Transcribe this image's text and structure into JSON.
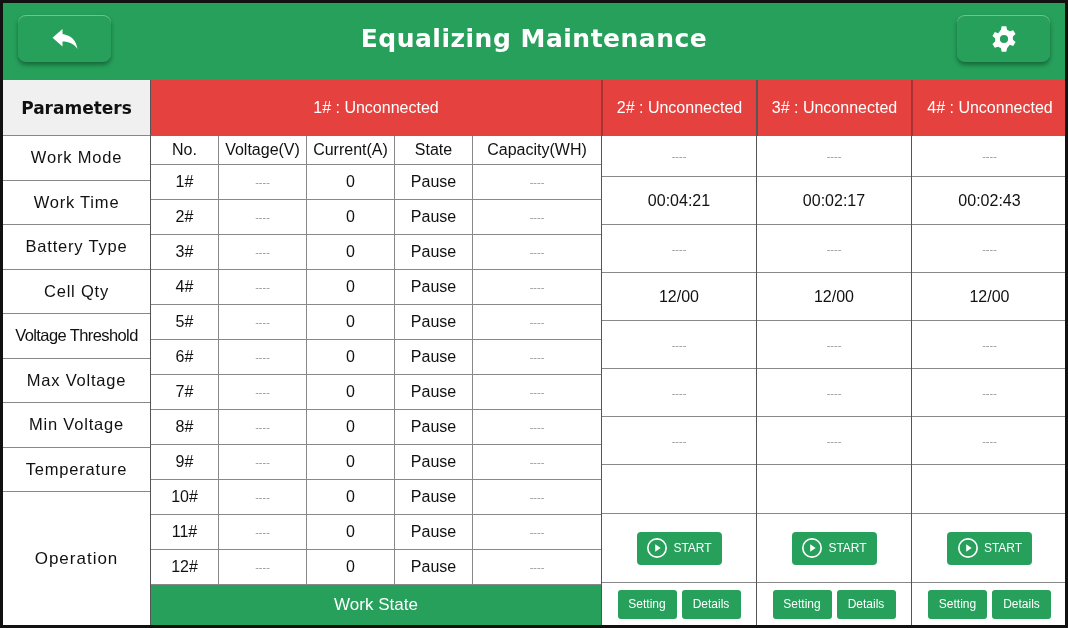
{
  "header": {
    "title": "Equalizing Maintenance"
  },
  "parameters": {
    "title": "Parameters",
    "items": [
      "Work Mode",
      "Work Time",
      "Battery Type",
      "Cell Qty",
      "Voltage Threshold",
      "Max Voltage",
      "Min Voltage",
      "Temperature"
    ],
    "operation": "Operation"
  },
  "device_1": {
    "status": "1# : Unconnected",
    "columns": [
      "No.",
      "Voltage(V)",
      "Current(A)",
      "State",
      "Capacity(WH)"
    ],
    "rows": [
      [
        "1#",
        "----",
        "0",
        "Pause",
        "----"
      ],
      [
        "2#",
        "----",
        "0",
        "Pause",
        "----"
      ],
      [
        "3#",
        "----",
        "0",
        "Pause",
        "----"
      ],
      [
        "4#",
        "----",
        "0",
        "Pause",
        "----"
      ],
      [
        "5#",
        "----",
        "0",
        "Pause",
        "----"
      ],
      [
        "6#",
        "----",
        "0",
        "Pause",
        "----"
      ],
      [
        "7#",
        "----",
        "0",
        "Pause",
        "----"
      ],
      [
        "8#",
        "----",
        "0",
        "Pause",
        "----"
      ],
      [
        "9#",
        "----",
        "0",
        "Pause",
        "----"
      ],
      [
        "10#",
        "----",
        "0",
        "Pause",
        "----"
      ],
      [
        "11#",
        "----",
        "0",
        "Pause",
        "----"
      ],
      [
        "12#",
        "----",
        "0",
        "Pause",
        "----"
      ]
    ],
    "footer": "Work State"
  },
  "devices": [
    {
      "status": "2# : Unconnected",
      "values": [
        "----",
        "00:04:21",
        "----",
        "12/00",
        "----",
        "----",
        "----"
      ],
      "start": "START",
      "buttons": [
        "Setting",
        "Details"
      ]
    },
    {
      "status": "3# : Unconnected",
      "values": [
        "----",
        "00:02:17",
        "----",
        "12/00",
        "----",
        "----",
        "----"
      ],
      "start": "START",
      "buttons": [
        "Setting",
        "Details"
      ]
    },
    {
      "status": "4# : Unconnected",
      "values": [
        "----",
        "00:02:43",
        "----",
        "12/00",
        "----",
        "----",
        "----"
      ],
      "start": "START",
      "buttons": [
        "Setting",
        "Details"
      ]
    }
  ]
}
